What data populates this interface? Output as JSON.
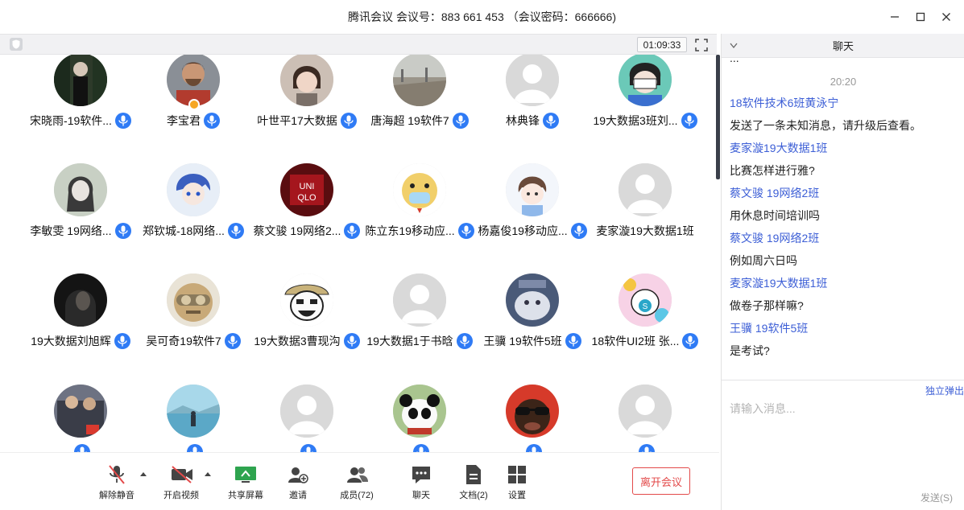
{
  "window": {
    "title": "腾讯会议 会议号：883 661 453 （会议密码：666666)",
    "minimize_glyph": "—",
    "maximize_glyph": "☐",
    "close_glyph": "✕"
  },
  "gridbar": {
    "timer": "01:09:33"
  },
  "participants": [
    {
      "name": "宋晓雨-19软件...",
      "avatar": "photo-dark-forest",
      "mic": true
    },
    {
      "name": "李宝君",
      "avatar": "photo-man-smiling",
      "mic": true,
      "host": true
    },
    {
      "name": "叶世平17大数据",
      "avatar": "photo-child",
      "mic": true
    },
    {
      "name": "唐海超 19软件7",
      "avatar": "photo-landscape",
      "mic": true
    },
    {
      "name": "林典锋",
      "avatar": "default",
      "mic": true
    },
    {
      "name": "19大数据3班刘...",
      "avatar": "anime-mask",
      "mic": true
    },
    {
      "name": "李敏雯  19网络...",
      "avatar": "photo-girl-bw",
      "mic": true
    },
    {
      "name": "郑钦城-18网络...",
      "avatar": "anime-blue-hair",
      "mic": true
    },
    {
      "name": "蔡文骏 19网络2...",
      "avatar": "uniqlo-logo",
      "mic": true
    },
    {
      "name": "陈立东19移动应...",
      "avatar": "cartoon-yellow-mask",
      "mic": true
    },
    {
      "name": "杨嘉俊19移动应...",
      "avatar": "cartoon-girl",
      "mic": true
    },
    {
      "name": "麦家漩19大数据1班",
      "avatar": "default",
      "mic": false
    },
    {
      "name": "19大数据刘旭辉",
      "avatar": "photo-dark-portrait",
      "mic": true
    },
    {
      "name": "吴可奇19软件7",
      "avatar": "cartoon-goggles",
      "mic": true
    },
    {
      "name": "19大数据3曹现沟",
      "avatar": "cartoon-hat-face",
      "mic": true
    },
    {
      "name": "19大数据1于书晗",
      "avatar": "default",
      "mic": true
    },
    {
      "name": "王骥  19软件5班",
      "avatar": "photo-cat",
      "mic": true
    },
    {
      "name": "18软件UI2班 张...",
      "avatar": "cartoon-colorful",
      "mic": true
    },
    {
      "name": "",
      "avatar": "photo-movie",
      "mic": true
    },
    {
      "name": "",
      "avatar": "photo-lake",
      "mic": true
    },
    {
      "name": "",
      "avatar": "default",
      "mic": true
    },
    {
      "name": "",
      "avatar": "photo-panda",
      "mic": true
    },
    {
      "name": "",
      "avatar": "photo-sunglasses",
      "mic": true
    },
    {
      "name": "",
      "avatar": "default",
      "mic": true
    }
  ],
  "toolbar": {
    "unmute": "解除静音",
    "start_video": "开启视频",
    "share_screen": "共享屏幕",
    "invite": "邀请",
    "members": "成员(72)",
    "chat": "聊天",
    "docs": "文档(2)",
    "settings": "设置",
    "leave": "离开会议"
  },
  "chat": {
    "title": "聊天",
    "cut_message": "...",
    "time": "20:20",
    "messages": [
      {
        "sender": "18软件技术6班黄泳宁",
        "text": "发送了一条未知消息，请升级后查看。"
      },
      {
        "sender": "麦家漩19大数据1班",
        "text": "比赛怎样进行雅?"
      },
      {
        "sender": "蔡文骏 19网络2班",
        "text": "用休息时间培训吗"
      },
      {
        "sender": "蔡文骏 19网络2班",
        "text": "例如周六日吗"
      },
      {
        "sender": "麦家漩19大数据1班",
        "text": "做卷子那样嘛?"
      },
      {
        "sender": "王骥  19软件5班",
        "text": "是考试?"
      }
    ],
    "popout": "独立弹出",
    "input_placeholder": "请输入消息...",
    "send": "发送(S)"
  },
  "colors": {
    "accent": "#2f7bf5",
    "sender": "#3d5fd6",
    "leave": "#e34a4a",
    "host_badge": "#f6a623"
  }
}
